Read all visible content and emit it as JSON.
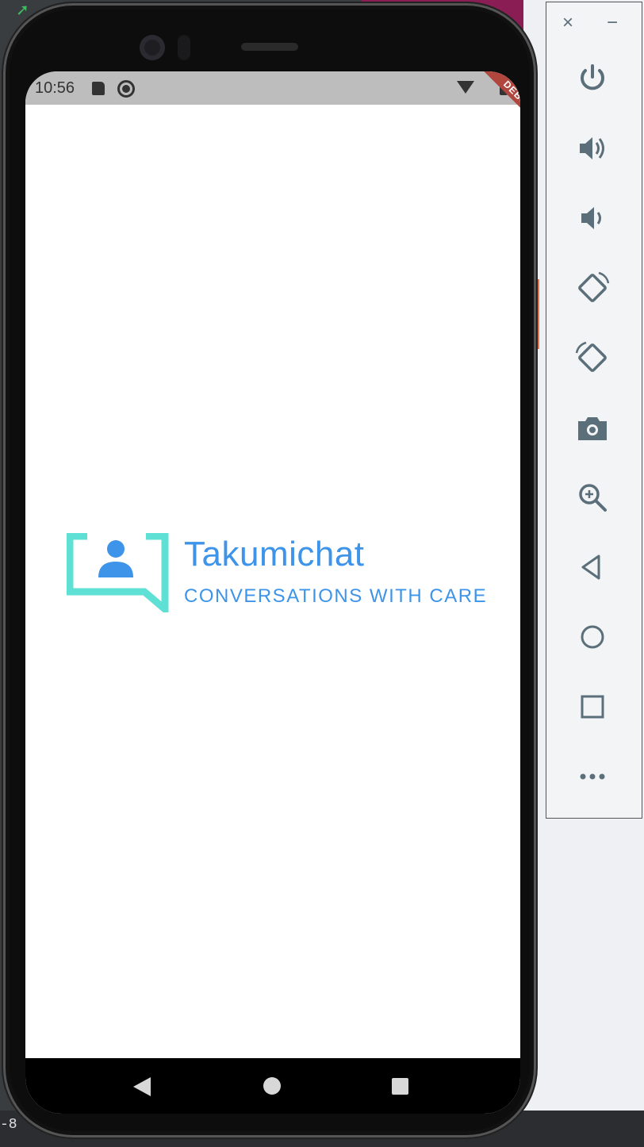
{
  "statusbar": {
    "time": "10:56"
  },
  "debug_banner": "DEBUG",
  "app": {
    "title": "Takumichat",
    "tagline": "CONVERSATIONS WITH CARE"
  },
  "desktop": {
    "corner_text": "-8"
  },
  "emulator_toolbar": {
    "close": "×",
    "minimize": "−",
    "buttons": [
      "power-icon",
      "volume-up-icon",
      "volume-down-icon",
      "rotate-left-icon",
      "rotate-right-icon",
      "camera-icon",
      "zoom-icon",
      "back-icon",
      "home-icon",
      "overview-icon",
      "more-icon"
    ]
  },
  "colors": {
    "brand_blue": "#3d94e8",
    "brand_teal": "#5fe0d4",
    "toolbar_icon": "#5b6f7a"
  }
}
